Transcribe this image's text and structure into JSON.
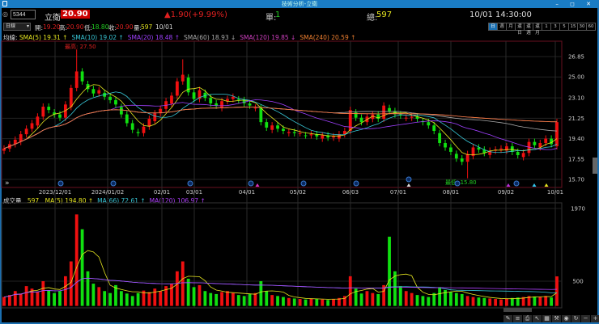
{
  "window": {
    "title": "技術分析-立衛",
    "controls": "– ◻ ✕"
  },
  "header": {
    "code": "5344",
    "name": "立衛",
    "price": "20.90",
    "change": "▲1.90(+9.99%)",
    "single_label": "單:",
    "single": "1",
    "total_label": "總:",
    "total": "597",
    "datetime": "10/01 14:30:00"
  },
  "quote": {
    "period_select": "日線",
    "open_label": "開:",
    "open": "19.20",
    "high_label": "高:",
    "high": "20.90",
    "low_label": "低:",
    "low": "18.80",
    "close_label": "收:",
    "close": "20.90",
    "vol_label": "量:",
    "vol": "597",
    "date": "10/01"
  },
  "periods": [
    "日",
    "週",
    "月",
    "還日",
    "還週",
    "還月",
    "1",
    "3",
    "5",
    "15",
    "30",
    "60"
  ],
  "ma_legend": {
    "label": "均線:",
    "items": [
      {
        "text": "SMA(5) 19.31 ↑",
        "color": "#e6e620"
      },
      {
        "text": "SMA(10) 19.02 ↑",
        "color": "#38c8d8"
      },
      {
        "text": "SMA(20) 18.48 ↑",
        "color": "#a040ff"
      },
      {
        "text": "SMA(60) 18.93 ↓",
        "color": "#aaaaaa"
      },
      {
        "text": "SMA(120) 19.85 ↓",
        "color": "#d040c0"
      },
      {
        "text": "SMA(240) 20.59 ↑",
        "color": "#f08030"
      }
    ]
  },
  "vol_legend": {
    "label": "成交量",
    "value": "597",
    "items": [
      {
        "text": "MA(5) 194.80 ↑",
        "color": "#e6e620"
      },
      {
        "text": "MA(66) 72.61 ↑",
        "color": "#38c8d8"
      },
      {
        "text": "MA(120) 106.97 ↑",
        "color": "#b040ff"
      }
    ]
  },
  "annotations": {
    "max": "最高: 27.50",
    "min": "最低: 15.80"
  },
  "chart_data": {
    "type": "candlestick",
    "price_ticks": [
      "26.85",
      "25.00",
      "23.10",
      "21.25",
      "19.40",
      "17.55",
      "15.70"
    ],
    "volume_ticks": [
      "1970",
      "500"
    ],
    "date_labels": [
      "2023/12/01",
      "2024/01/02",
      "02/01",
      "03/01",
      "04/01",
      "05/02",
      "06/03",
      "07/01",
      "08/01",
      "09/02",
      "10/01"
    ],
    "closes": [
      18.5,
      18.9,
      19.3,
      19.8,
      20.3,
      20.8,
      21.4,
      22.3,
      22.0,
      21.6,
      21.3,
      22.5,
      24.0,
      25.5,
      24.6,
      23.9,
      23.5,
      23.8,
      23.2,
      22.9,
      22.5,
      21.6,
      20.8,
      20.2,
      19.9,
      20.5,
      21.2,
      21.7,
      22.1,
      22.8,
      23.3,
      24.6,
      25.2,
      23.6,
      23.0,
      23.8,
      23.1,
      22.6,
      22.4,
      22.8,
      23.0,
      23.2,
      22.9,
      22.6,
      22.4,
      22.2,
      20.9,
      20.4,
      20.6,
      20.3,
      20.1,
      20.0,
      19.9,
      19.9,
      19.7,
      19.8,
      19.6,
      19.7,
      19.5,
      19.6,
      19.8,
      20.1,
      22.0,
      21.3,
      20.9,
      21.4,
      21.6,
      21.2,
      22.4,
      21.9,
      21.6,
      21.5,
      21.3,
      21.4,
      21.2,
      20.9,
      20.6,
      20.1,
      19.0,
      18.6,
      18.2,
      17.6,
      17.3,
      18.0,
      18.6,
      18.4,
      18.1,
      18.3,
      18.4,
      18.5,
      18.7,
      18.2,
      17.9,
      18.1,
      19.1,
      18.8,
      19.0,
      19.4,
      18.9,
      20.9
    ],
    "high_override": {
      "13": 27.5,
      "32": 26.6
    },
    "low_override": {
      "83": 15.8
    },
    "volumes": [
      180,
      220,
      300,
      250,
      400,
      350,
      280,
      500,
      320,
      260,
      300,
      600,
      900,
      1850,
      1550,
      700,
      450,
      380,
      300,
      260,
      420,
      300,
      250,
      200,
      260,
      310,
      280,
      350,
      300,
      400,
      450,
      700,
      900,
      550,
      380,
      420,
      300,
      260,
      240,
      280,
      300,
      260,
      220,
      200,
      240,
      260,
      500,
      300,
      220,
      200,
      180,
      160,
      150,
      140,
      130,
      150,
      140,
      130,
      120,
      140,
      160,
      200,
      600,
      350,
      250,
      300,
      260,
      240,
      420,
      1400,
      700,
      400,
      300,
      260,
      220,
      200,
      180,
      260,
      380,
      320,
      280,
      260,
      240,
      200,
      180,
      170,
      160,
      150,
      140,
      130,
      150,
      160,
      170,
      180,
      200,
      190,
      180,
      200,
      170,
      597
    ]
  }
}
